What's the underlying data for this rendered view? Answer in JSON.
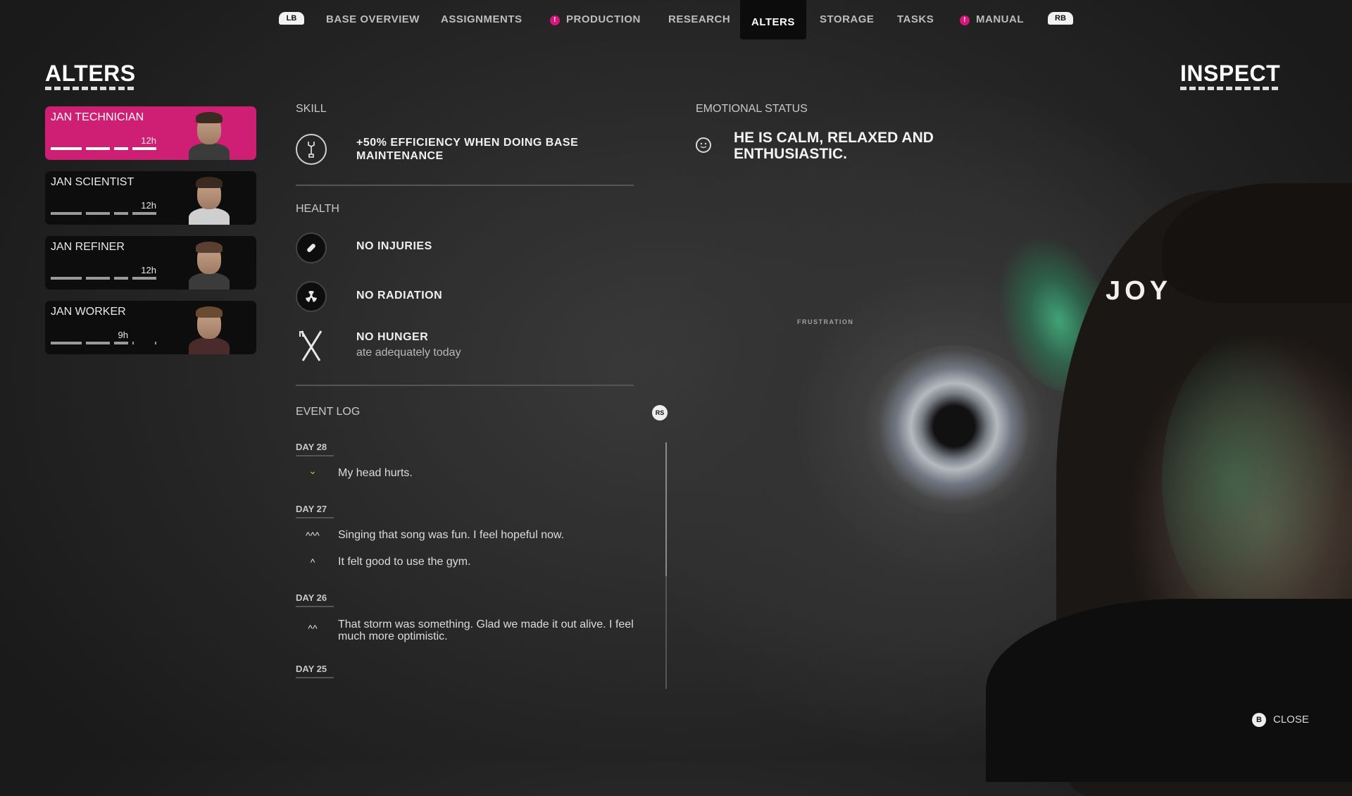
{
  "nav": {
    "left_bumper": "LB",
    "right_bumper": "RB",
    "items": [
      {
        "label": "BASE OVERVIEW"
      },
      {
        "label": "ASSIGNMENTS"
      },
      {
        "label": "PRODUCTION",
        "alert": "!"
      },
      {
        "label": "RESEARCH"
      },
      {
        "label": "ALTERS",
        "active": true
      },
      {
        "label": "STORAGE"
      },
      {
        "label": "TASKS"
      },
      {
        "label": "MANUAL",
        "alert": "!"
      }
    ]
  },
  "alters_panel": {
    "title": "ALTERS",
    "cards": [
      {
        "name": "JAN TECHNICIAN",
        "time": "12h",
        "selected": true,
        "bars_filled": 4
      },
      {
        "name": "JAN SCIENTIST",
        "time": "12h",
        "selected": false,
        "bars_filled": 4
      },
      {
        "name": "JAN REFINER",
        "time": "12h",
        "selected": false,
        "bars_filled": 4
      },
      {
        "name": "JAN WORKER",
        "time": "9h",
        "selected": false,
        "bars_filled": 3
      }
    ]
  },
  "skill": {
    "label": "SKILL",
    "icon": "wrench-icon",
    "text": "+50% EFFICIENCY WHEN DOING BASE MAINTENANCE"
  },
  "health": {
    "label": "HEALTH",
    "items": [
      {
        "icon": "bandage-icon",
        "text": "NO INJURIES"
      },
      {
        "icon": "radiation-icon",
        "text": "NO RADIATION"
      },
      {
        "icon": "fork-knife-icon",
        "text": "NO HUNGER",
        "sub": "ate adequately today"
      }
    ]
  },
  "event_log": {
    "label": "EVENT LOG",
    "scroll_button": "RS",
    "days": [
      {
        "day": "DAY 28",
        "events": [
          {
            "icon": "⌄",
            "mood": "down",
            "text": "My head hurts."
          }
        ]
      },
      {
        "day": "DAY 27",
        "events": [
          {
            "icon": "^^^",
            "mood": "up3",
            "text": "Singing that song was fun. I feel hopeful now."
          },
          {
            "icon": "^",
            "mood": "up1",
            "text": "It felt good to use the gym."
          }
        ]
      },
      {
        "day": "DAY 26",
        "events": [
          {
            "icon": "^^",
            "mood": "up2",
            "text": "That storm was something. Glad we made it out alive. I feel much more optimistic."
          }
        ]
      },
      {
        "day": "DAY 25",
        "events": []
      }
    ]
  },
  "emotional_status": {
    "label": "EMOTIONAL STATUS",
    "icon": "smiley-icon",
    "text": "HE IS CALM, RELAXED AND ENTHUSIASTIC.",
    "primary_emotion": "JOY",
    "secondary_emotion": "FRUSTRATION"
  },
  "inspect": {
    "title": "INSPECT"
  },
  "footer": {
    "close_button": "B",
    "close_label": "CLOSE"
  },
  "colors": {
    "accent": "#cf1f74",
    "alert": "#d6157a",
    "event_down": "#e3b53b"
  }
}
